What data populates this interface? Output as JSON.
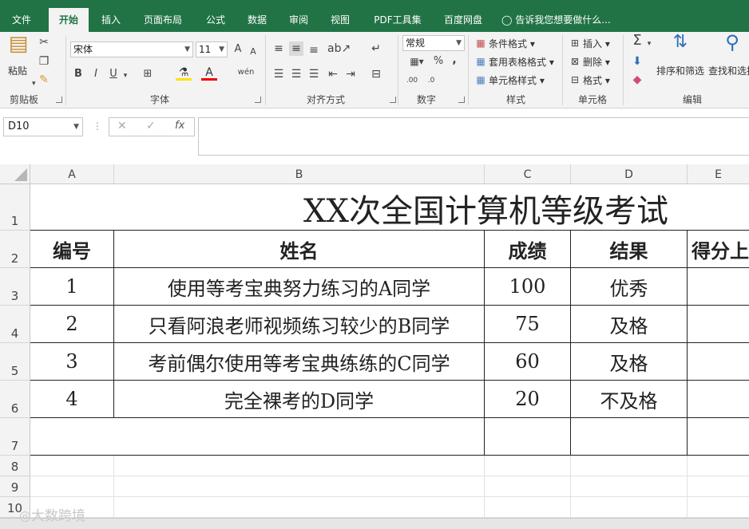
{
  "tabs": [
    "文件",
    "开始",
    "插入",
    "页面布局",
    "公式",
    "数据",
    "审阅",
    "视图",
    "PDF工具集",
    "百度网盘"
  ],
  "active_tab": "开始",
  "tellme": "告诉我您想要做什么...",
  "ribbon": {
    "clipboard": {
      "label": "剪贴板",
      "paste": "粘贴"
    },
    "font": {
      "label": "字体",
      "name": "宋体",
      "size": "11",
      "bold": "B",
      "italic": "I",
      "underline": "U",
      "grow": "A",
      "shrink": "A",
      "phonetic": "wén"
    },
    "alignment": {
      "label": "对齐方式"
    },
    "number": {
      "label": "数字",
      "format": "常规",
      "percent": "%",
      "comma": ","
    },
    "styles": {
      "label": "样式",
      "conditional": "条件格式",
      "table": "套用表格格式",
      "cell": "单元格样式"
    },
    "cells": {
      "label": "单元格",
      "insert": "插入",
      "delete": "删除",
      "format": "格式"
    },
    "editing": {
      "label": "编辑",
      "sort": "排序和筛选",
      "find": "查找和选择"
    }
  },
  "namebox": "D10",
  "fx": "fx",
  "columns": [
    "A",
    "B",
    "C",
    "D",
    "E"
  ],
  "rows": [
    "1",
    "2",
    "3",
    "4",
    "5",
    "6",
    "7",
    "8",
    "9",
    "10"
  ],
  "sheet": {
    "title": "XX次全国计算机等级考试",
    "headers": [
      "编号",
      "姓名",
      "成绩",
      "结果",
      "得分上"
    ],
    "data": [
      [
        "1",
        "使用等考宝典努力练习的A同学",
        "100",
        "优秀"
      ],
      [
        "2",
        "只看阿浪老师视频练习较少的B同学",
        "75",
        "及格"
      ],
      [
        "3",
        "考前偶尔使用等考宝典练练的C同学",
        "60",
        "及格"
      ],
      [
        "4",
        "完全裸考的D同学",
        "20",
        "不及格"
      ]
    ]
  },
  "watermark": "大数跨境",
  "colors": {
    "accent": "#217346"
  }
}
